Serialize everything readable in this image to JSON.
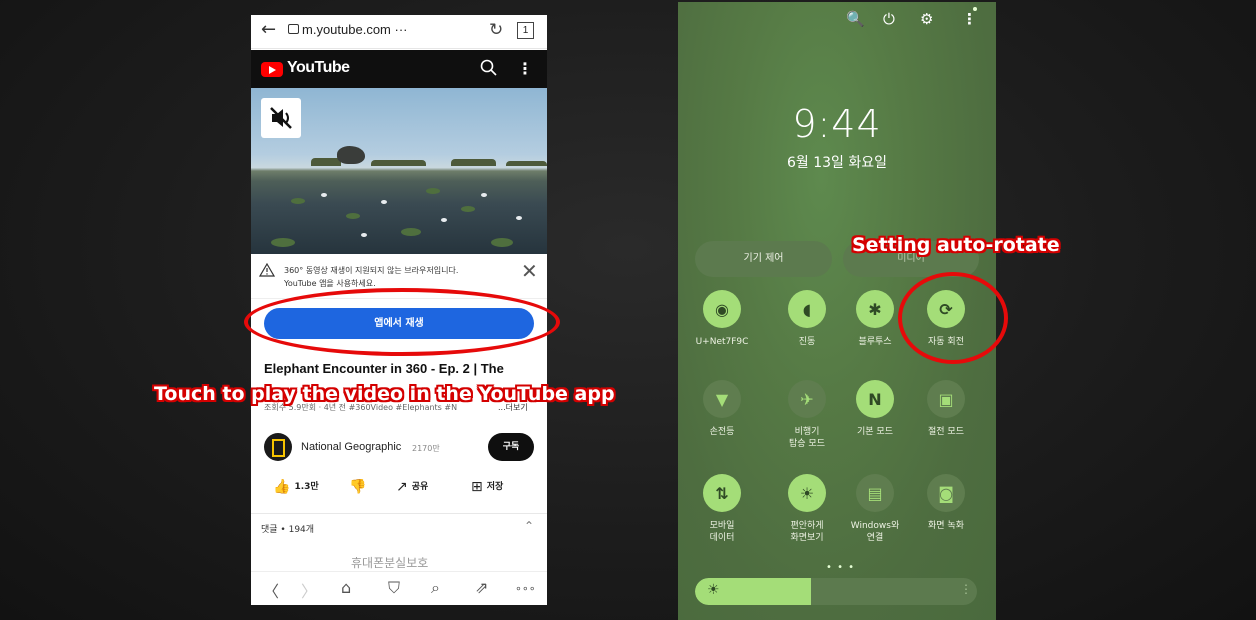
{
  "browser": {
    "back_glyph": "←",
    "url": "m.youtube.com ···",
    "reload_glyph": "↻",
    "tab_count": "1"
  },
  "youtube": {
    "logo_text": "YouTube",
    "menu_glyph": "⋮",
    "notice_line1": "360° 동영상 재생이 지원되지 않는 브라우저입니다.",
    "notice_line2": "YouTube 앱을 사용하세요.",
    "close_glyph": "✕",
    "play_in_app_label": "앱에서 재생",
    "video_title": "Elephant Encounter in 360 - Ep. 2 | The",
    "video_meta": "조회수 5.9만회 · 4년 전 #360Video #Elephants #N",
    "more_label": "...더보기",
    "channel_name": "National Geographic",
    "subscriber_count": "2170만",
    "subscribe_label": "구독",
    "actions": [
      {
        "icon": "thumbs-up-icon",
        "glyph": "👍",
        "label": "1.3만"
      },
      {
        "icon": "thumbs-down-icon",
        "glyph": "👎",
        "label": ""
      },
      {
        "icon": "share-icon",
        "glyph": "↗",
        "label": "공유"
      },
      {
        "icon": "save-icon",
        "glyph": "⊞",
        "label": "저장"
      }
    ],
    "comments_label": "댓글 • 194개",
    "comments_chevron": "⌃",
    "ad_text": "휴대폰분실보호"
  },
  "browser_nav": {
    "back": "〈",
    "forward": "〉",
    "home": "⌂",
    "bookmark": "⛉",
    "search": "⌕",
    "share": "⇗",
    "more": "∘∘∘"
  },
  "quick_panel": {
    "top_icons": [
      {
        "name": "search-icon",
        "glyph": "🔍"
      },
      {
        "name": "power-icon",
        "glyph": "⏻"
      },
      {
        "name": "settings-icon",
        "glyph": "⚙"
      },
      {
        "name": "more-icon",
        "glyph": "⋮"
      }
    ],
    "time": "9:44",
    "date": "6월 13일 화요일",
    "device_control_label": "기기 제어",
    "media_output_label": "미디어",
    "tiles": [
      {
        "name": "wifi-tile",
        "icon": "wifi-icon",
        "glyph": "◉",
        "label": "U+Net7F9C",
        "state": "on"
      },
      {
        "name": "vibrate-tile",
        "icon": "vibrate-icon",
        "glyph": "◖",
        "label": "진동",
        "state": "on"
      },
      {
        "name": "bluetooth-tile",
        "icon": "bluetooth-icon",
        "glyph": "✱",
        "label": "블루투스",
        "state": "on"
      },
      {
        "name": "auto-rotate-tile",
        "icon": "auto-rotate-icon",
        "glyph": "⟳",
        "label": "자동 회전",
        "state": "on"
      },
      {
        "name": "flashlight-tile",
        "icon": "flashlight-icon",
        "glyph": "▼",
        "label": "손전등",
        "state": "off"
      },
      {
        "name": "airplane-tile",
        "icon": "airplane-icon",
        "glyph": "✈",
        "label": "비행기\n탑승 모드",
        "state": "off"
      },
      {
        "name": "standard-mode-tile",
        "icon": "nfc-icon",
        "glyph": "N",
        "label": "기본 모드",
        "state": "on"
      },
      {
        "name": "power-saving-tile",
        "icon": "battery-icon",
        "glyph": "▣",
        "label": "절전 모드",
        "state": "off"
      },
      {
        "name": "mobile-data-tile",
        "icon": "mobile-data-icon",
        "glyph": "⇅",
        "label": "모바일\n데이터",
        "state": "on"
      },
      {
        "name": "eye-comfort-tile",
        "icon": "eye-comfort-icon",
        "glyph": "☀",
        "label": "편안하게\n화면보기",
        "state": "on"
      },
      {
        "name": "link-windows-tile",
        "icon": "link-windows-icon",
        "glyph": "▤",
        "label": "Windows와\n연결",
        "state": "off"
      },
      {
        "name": "screen-record-tile",
        "icon": "screen-record-icon",
        "glyph": "◙",
        "label": "화면 녹화",
        "state": "off"
      }
    ],
    "page_dots": "• • •",
    "brightness_level": 0.41,
    "brightness_sun": "☀",
    "brightness_more": "⋮"
  },
  "annotations": {
    "left_caption": "Touch to play the video in the YouTube app",
    "right_caption": "Setting auto-rotate",
    "highlight_color": "#e60a0a"
  }
}
